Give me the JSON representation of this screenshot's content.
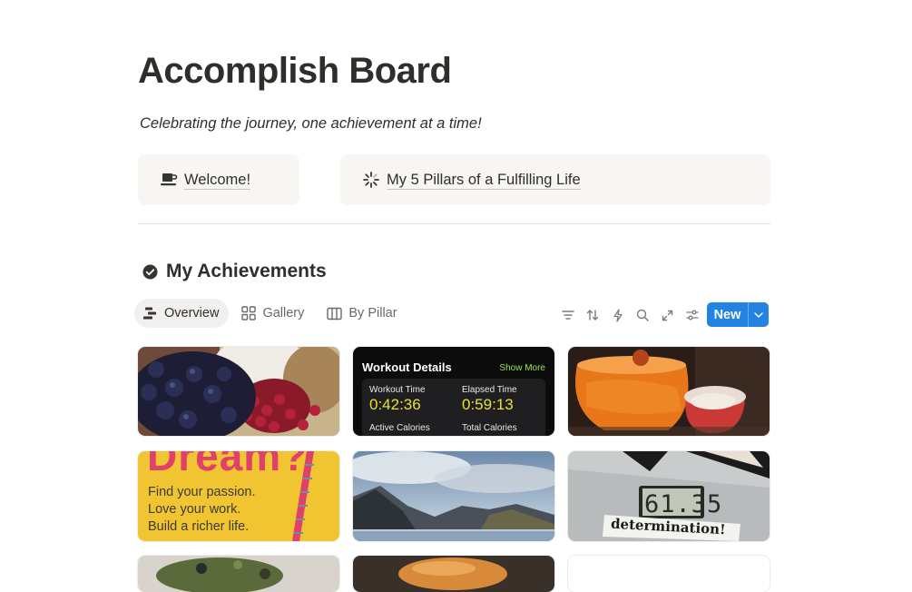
{
  "page": {
    "title": "Accomplish Board",
    "subtitle": "Celebrating the journey, one achievement at a time!"
  },
  "callouts": [
    {
      "label": "Welcome!",
      "icon": "coffee-icon"
    },
    {
      "label": "My 5 Pillars of a Fulfilling Life",
      "icon": "loading-icon"
    }
  ],
  "section": {
    "title": "My Achievements",
    "icon": "check-circle-icon"
  },
  "views": [
    {
      "label": "Overview",
      "icon": "timeline-icon",
      "active": true
    },
    {
      "label": "Gallery",
      "icon": "gallery-icon",
      "active": false
    },
    {
      "label": "By Pillar",
      "icon": "board-icon",
      "active": false
    }
  ],
  "toolbar": {
    "icons": [
      "filter-icon",
      "sort-icon",
      "automation-icon",
      "search-icon",
      "expand-icon",
      "settings-icon"
    ],
    "new_label": "New"
  },
  "cards": {
    "workout": {
      "title": "Workout Details",
      "show_more": "Show More",
      "workout_time_label": "Workout Time",
      "workout_time": "0:42:36",
      "elapsed_time_label": "Elapsed Time",
      "elapsed_time": "0:59:13",
      "active_calories_label": "Active Calories",
      "total_calories_label": "Total Calories"
    },
    "dream": {
      "word": "Dream?",
      "lines": [
        "Find your passion.",
        "Love your work.",
        "Build a richer life."
      ]
    },
    "scale": {
      "reading": "61.35",
      "caption": "determination!"
    }
  },
  "colors": {
    "accent": "#2383e2",
    "callout_bg": "#f7f6f3",
    "workout_highlight": "#e8e233",
    "show_more": "#9ae35a",
    "dream_pink": "#e0406a",
    "dream_yellow": "#f0c531"
  }
}
